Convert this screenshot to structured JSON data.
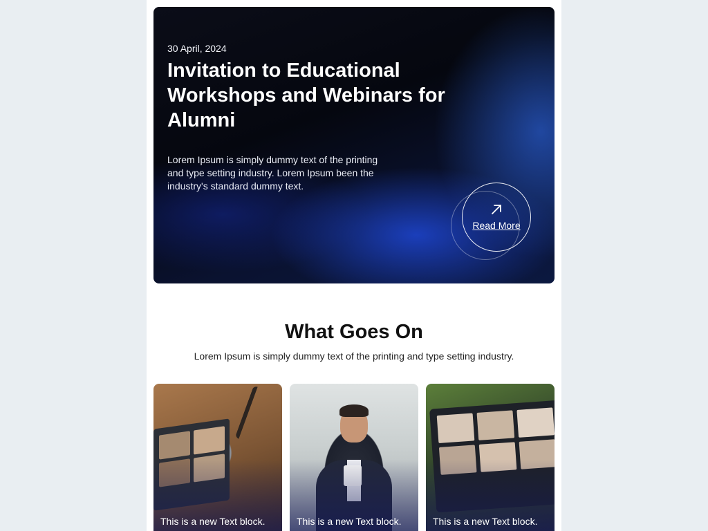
{
  "hero": {
    "date": "30 April, 2024",
    "title": "Invitation to Educational Workshops and Webinars for Alumni",
    "description": "Lorem Ipsum is simply dummy text of the printing and type setting industry. Lorem Ipsum been the industry's standard dummy text.",
    "read_more_label": "Read More",
    "read_more_icon": "arrow-up-right-icon"
  },
  "section": {
    "title": "What Goes On",
    "subtitle": "Lorem Ipsum is simply dummy text of the printing and type setting industry."
  },
  "cards": [
    {
      "caption": "This is a new Text block."
    },
    {
      "caption": "This is a new Text block."
    },
    {
      "caption": "This is a new Text block."
    }
  ],
  "colors": {
    "page_background": "#e9eef2",
    "hero_accent": "#1e46d2",
    "text_dark": "#111111"
  }
}
